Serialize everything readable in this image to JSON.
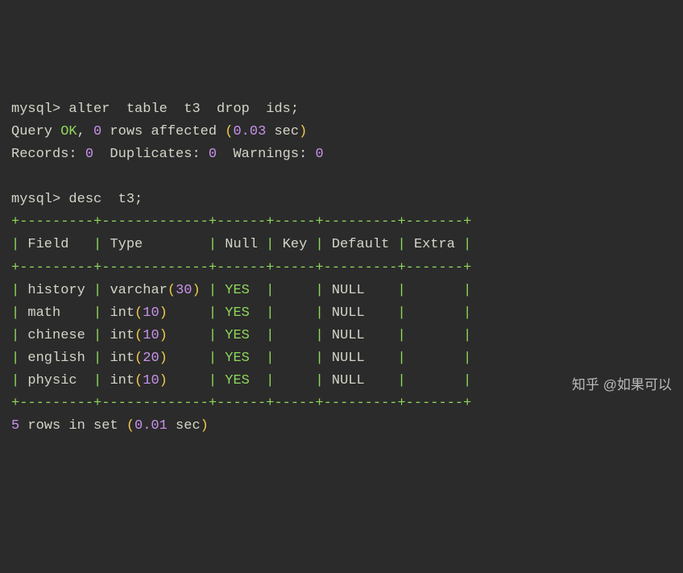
{
  "cmd1": {
    "prompt": "mysql>",
    "sql": "alter  table  t3  drop  ids;",
    "result_prefix": "Query ",
    "ok": "OK",
    "rows_affected_pre": ", ",
    "rows_affected_num": "0",
    "rows_affected_post": " rows affected ",
    "paren_open": "(",
    "time": "0.03",
    "time_unit": " sec",
    "paren_close": ")",
    "records_label": "Records: ",
    "records_val": "0",
    "dup_label": "  Duplicates: ",
    "dup_val": "0",
    "warn_label": "  Warnings: ",
    "warn_val": "0"
  },
  "cmd2": {
    "prompt": "mysql>",
    "sql": "desc  t3;"
  },
  "table": {
    "border_top": "+---------+-------------+------+-----+---------+-------+",
    "border_mid": "+---------+-------------+------+-----+---------+-------+",
    "border_bot": "+---------+-------------+------+-----+---------+-------+",
    "headers": [
      "Field",
      "Type",
      "Null",
      "Key",
      "Default",
      "Extra"
    ],
    "rows": [
      {
        "field": "history",
        "type_kw": "varchar",
        "type_n": "30",
        "null": "YES",
        "key": "",
        "default": "NULL",
        "extra": ""
      },
      {
        "field": "math",
        "type_kw": "int",
        "type_n": "10",
        "null": "YES",
        "key": "",
        "default": "NULL",
        "extra": ""
      },
      {
        "field": "chinese",
        "type_kw": "int",
        "type_n": "10",
        "null": "YES",
        "key": "",
        "default": "NULL",
        "extra": ""
      },
      {
        "field": "english",
        "type_kw": "int",
        "type_n": "20",
        "null": "YES",
        "key": "",
        "default": "NULL",
        "extra": ""
      },
      {
        "field": "physic",
        "type_kw": "int",
        "type_n": "10",
        "null": "YES",
        "key": "",
        "default": "NULL",
        "extra": ""
      }
    ]
  },
  "footer": {
    "rows_num": "5",
    "rows_text": " rows in set ",
    "paren_open": "(",
    "time": "0.01",
    "time_unit": " sec",
    "paren_close": ")"
  },
  "watermark": "知乎 @如果可以",
  "widths": {
    "field": 7,
    "type": 11,
    "null": 4,
    "key": 3,
    "default": 7,
    "extra": 5
  }
}
